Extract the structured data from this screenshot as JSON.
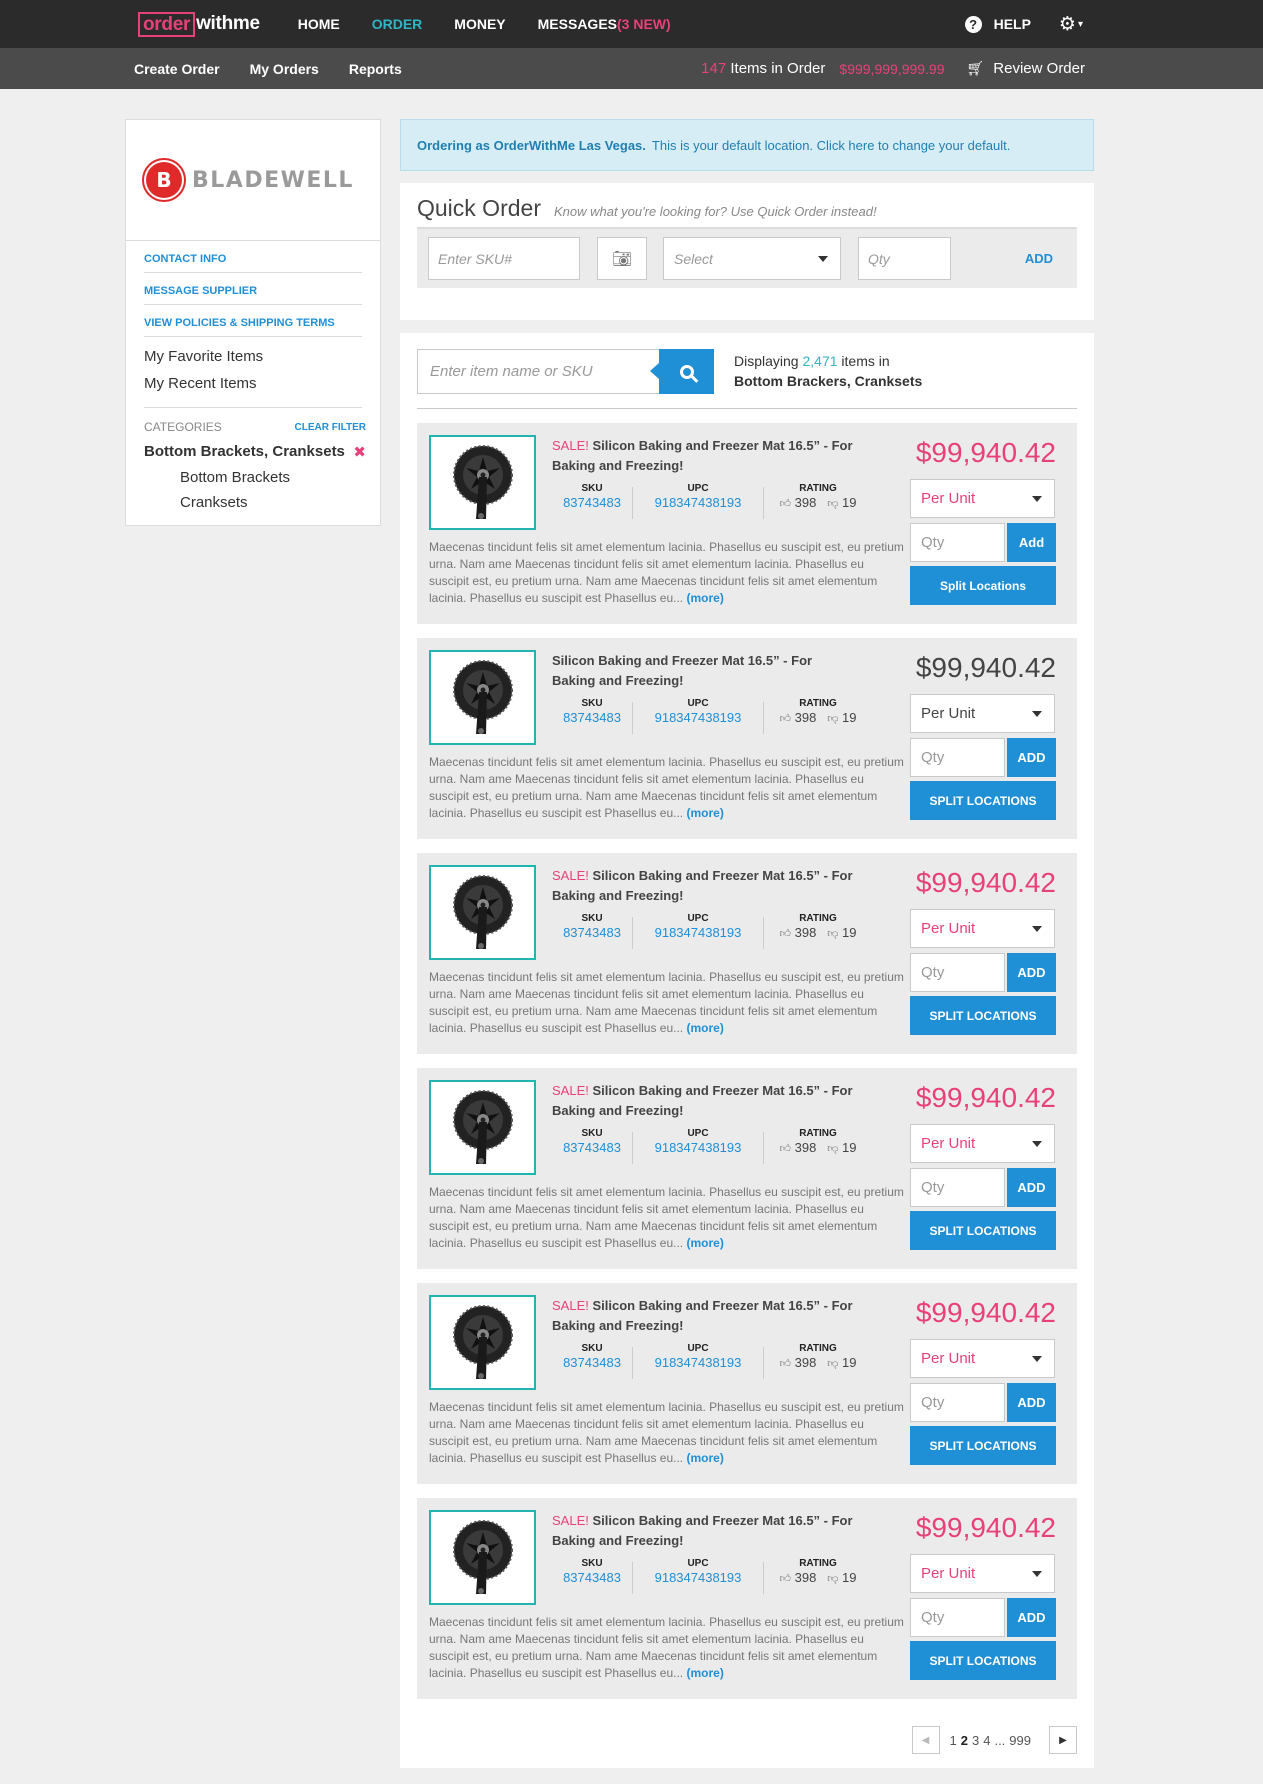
{
  "brand": {
    "order": "order",
    "withme": "withme"
  },
  "topnav": {
    "home": "HOME",
    "order": "ORDER",
    "money": "MONEY",
    "messages": "MESSAGES",
    "messages_new": "(3 new)",
    "help": "HELP"
  },
  "subnav": {
    "create_order": "Create Order",
    "my_orders": "My Orders",
    "reports": "Reports",
    "item_count": "147",
    "items_label": "Items in Order",
    "total": "$999,999,999.99",
    "review": "Review Order"
  },
  "sidebar": {
    "supplier_name": "BLADEWELL",
    "supplier_initial": "B",
    "links": [
      "CONTACT INFO",
      "MESSAGE SUPPLIER",
      "VIEW POLICIES & SHIPPING TERMS"
    ],
    "favorites": "My Favorite Items",
    "recent": "My Recent Items",
    "categories_label": "CATEGORIES",
    "clear_filter": "CLEAR FILTER",
    "active_category": "Bottom Brackets, Cranksets",
    "subcategories": [
      "Bottom Brackets",
      "Cranksets"
    ]
  },
  "alert": {
    "strong": "Ordering as OrderWithMe Las Vegas.",
    "text": "This is your default location. Click here to change your default."
  },
  "quick_order": {
    "title": "Quick Order",
    "subtitle": "Know what you're looking for? Use Quick Order instead!",
    "sku_placeholder": "Enter SKU#",
    "select_placeholder": "Select",
    "qty_placeholder": "Qty",
    "add": "ADD"
  },
  "listing": {
    "search_placeholder": "Enter item name or SKU",
    "displaying": "Displaying",
    "count": "2,471",
    "items_in": "items in",
    "category": "Bottom Brackers, Cranksets"
  },
  "product_template": {
    "sku_label": "SKU",
    "upc_label": "UPC",
    "rating_label": "RATING",
    "qty_placeholder": "Qty",
    "more": "(more)"
  },
  "products": [
    {
      "sale": "SALE!",
      "title": "Silicon Baking and Freezer Mat 16.5” - For Baking and Freezing!",
      "sku": "83743483",
      "upc": "918347438193",
      "likes": "398",
      "dislikes": "19",
      "description": "Maecenas tincidunt felis sit amet elementum lacinia. Phasellus eu suscipit est, eu pretium urna. Nam ame Maecenas tincidunt felis sit amet elementum lacinia. Phasellus eu suscipit est, eu pretium urna. Nam ame Maecenas tincidunt felis sit amet elementum lacinia. Phasellus eu suscipit est Phasellus eu...",
      "price": "$99,940.42",
      "unit": "Per Unit",
      "add": "Add",
      "split": "Split Locations",
      "on_sale": true
    },
    {
      "sale": "",
      "title": "Silicon Baking and Freezer Mat 16.5” - For Baking and Freezing!",
      "sku": "83743483",
      "upc": "918347438193",
      "likes": "398",
      "dislikes": "19",
      "description": "Maecenas tincidunt felis sit amet elementum lacinia. Phasellus eu suscipit est, eu pretium urna. Nam ame Maecenas tincidunt felis sit amet elementum lacinia. Phasellus eu suscipit est, eu pretium urna. Nam ame Maecenas tincidunt felis sit amet elementum lacinia. Phasellus eu suscipit est Phasellus eu...",
      "price": "$99,940.42",
      "unit": "Per Unit",
      "add": "ADD",
      "split": "SPLIT LOCATIONS",
      "on_sale": false
    },
    {
      "sale": "SALE!",
      "title": "Silicon Baking and Freezer Mat 16.5” - For Baking and Freezing!",
      "sku": "83743483",
      "upc": "918347438193",
      "likes": "398",
      "dislikes": "19",
      "description": "Maecenas tincidunt felis sit amet elementum lacinia. Phasellus eu suscipit est, eu pretium urna. Nam ame Maecenas tincidunt felis sit amet elementum lacinia. Phasellus eu suscipit est, eu pretium urna. Nam ame Maecenas tincidunt felis sit amet elementum lacinia. Phasellus eu suscipit est Phasellus eu...",
      "price": "$99,940.42",
      "unit": "Per Unit",
      "add": "ADD",
      "split": "SPLIT LOCATIONS",
      "on_sale": true
    },
    {
      "sale": "SALE!",
      "title": "Silicon Baking and Freezer Mat 16.5” - For Baking and Freezing!",
      "sku": "83743483",
      "upc": "918347438193",
      "likes": "398",
      "dislikes": "19",
      "description": "Maecenas tincidunt felis sit amet elementum lacinia. Phasellus eu suscipit est, eu pretium urna. Nam ame Maecenas tincidunt felis sit amet elementum lacinia. Phasellus eu suscipit est, eu pretium urna. Nam ame Maecenas tincidunt felis sit amet elementum lacinia. Phasellus eu suscipit est Phasellus eu...",
      "price": "$99,940.42",
      "unit": "Per Unit",
      "add": "ADD",
      "split": "SPLIT LOCATIONS",
      "on_sale": true
    },
    {
      "sale": "SALE!",
      "title": "Silicon Baking and Freezer Mat 16.5” - For Baking and Freezing!",
      "sku": "83743483",
      "upc": "918347438193",
      "likes": "398",
      "dislikes": "19",
      "description": "Maecenas tincidunt felis sit amet elementum lacinia. Phasellus eu suscipit est, eu pretium urna. Nam ame Maecenas tincidunt felis sit amet elementum lacinia. Phasellus eu suscipit est, eu pretium urna. Nam ame Maecenas tincidunt felis sit amet elementum lacinia. Phasellus eu suscipit est Phasellus eu...",
      "price": "$99,940.42",
      "unit": "Per Unit",
      "add": "ADD",
      "split": "SPLIT LOCATIONS",
      "on_sale": true
    },
    {
      "sale": "SALE!",
      "title": "Silicon Baking and Freezer Mat 16.5” - For Baking and Freezing!",
      "sku": "83743483",
      "upc": "918347438193",
      "likes": "398",
      "dislikes": "19",
      "description": "Maecenas tincidunt felis sit amet elementum lacinia. Phasellus eu suscipit est, eu pretium urna. Nam ame Maecenas tincidunt felis sit amet elementum lacinia. Phasellus eu suscipit est, eu pretium urna. Nam ame Maecenas tincidunt felis sit amet elementum lacinia. Phasellus eu suscipit est Phasellus eu...",
      "price": "$99,940.42",
      "unit": "Per Unit",
      "add": "ADD",
      "split": "SPLIT LOCATIONS",
      "on_sale": true
    }
  ],
  "pagination": {
    "pages": [
      "1",
      "2",
      "3",
      "4",
      "...",
      "999"
    ],
    "current": "2"
  },
  "colors": {
    "accent_pink": "#e8407a",
    "accent_blue": "#1f8fd6",
    "accent_teal": "#2fb6c4",
    "nav_dark": "#2b2b2b"
  },
  "icons": [
    "help-icon",
    "gear-icon",
    "chevron-down-icon",
    "cart-icon",
    "camera-icon",
    "search-icon",
    "close-icon",
    "thumbs-up-icon",
    "thumbs-down-icon",
    "caret-down-icon",
    "chevron-left-icon",
    "chevron-right-icon"
  ]
}
